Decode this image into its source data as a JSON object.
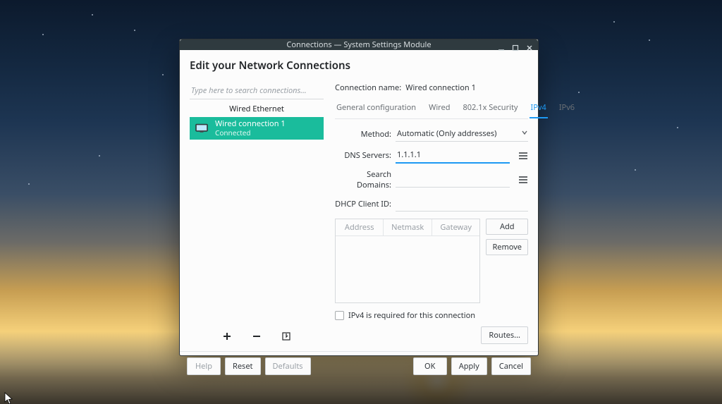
{
  "window": {
    "title": "Connections — System Settings Module"
  },
  "page": {
    "heading": "Edit your Network Connections"
  },
  "sidebar": {
    "search_placeholder": "Type here to search connections...",
    "category": "Wired Ethernet",
    "items": [
      {
        "name": "Wired connection 1",
        "status": "Connected",
        "selected": true
      }
    ],
    "toolbar": {
      "add_tooltip": "+",
      "remove_tooltip": "−",
      "export_tooltip": "Export"
    }
  },
  "details": {
    "name_label": "Connection name:",
    "name_value": "Wired connection 1",
    "tabs": [
      {
        "id": "general",
        "label": "General configuration",
        "active": false
      },
      {
        "id": "wired",
        "label": "Wired",
        "active": false
      },
      {
        "id": "8021x",
        "label": "802.1x Security",
        "active": false
      },
      {
        "id": "ipv4",
        "label": "IPv4",
        "active": true
      },
      {
        "id": "ipv6",
        "label": "IPv6",
        "active": false
      }
    ],
    "ipv4": {
      "method_label": "Method:",
      "method_value": "Automatic (Only addresses)",
      "dns_label": "DNS Servers:",
      "dns_value": "1.1.1.1",
      "search_label": "Search Domains:",
      "search_value": "",
      "dhcp_label": "DHCP Client ID:",
      "dhcp_value": "",
      "table_headers": {
        "address": "Address",
        "netmask": "Netmask",
        "gateway": "Gateway"
      },
      "add_label": "Add",
      "remove_label": "Remove",
      "required_label": "IPv4 is required for this connection",
      "required_checked": false,
      "routes_label": "Routes..."
    }
  },
  "footer": {
    "help": "Help",
    "reset": "Reset",
    "defaults": "Defaults",
    "ok": "OK",
    "apply": "Apply",
    "cancel": "Cancel"
  }
}
